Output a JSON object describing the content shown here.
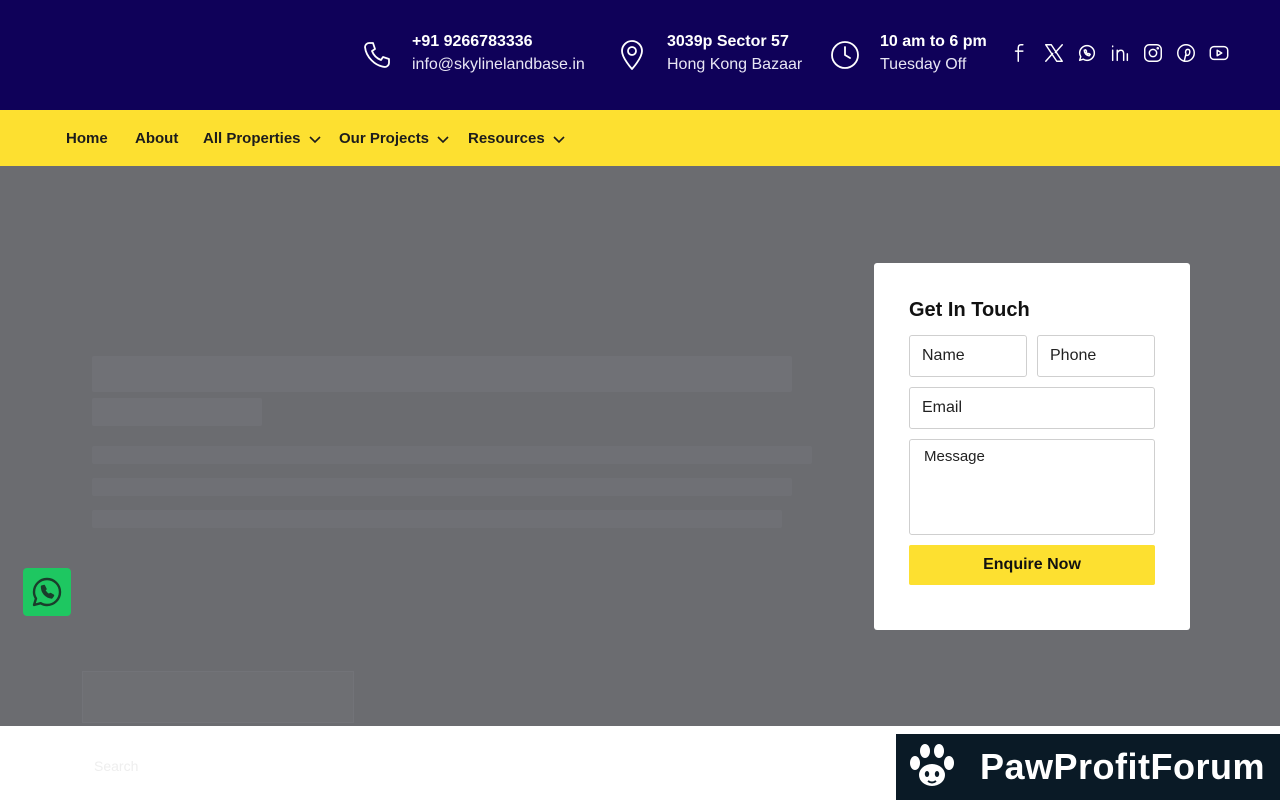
{
  "topbar": {
    "phone": {
      "title": "+91 9266783336",
      "subtitle": "info@skylinelandbase.in",
      "icon": "phone-icon"
    },
    "address": {
      "title": "3039p Sector 57",
      "subtitle": "Hong Kong Bazaar",
      "icon": "location-pin-icon"
    },
    "hours": {
      "title": "10 am to 6 pm",
      "subtitle": "Tuesday Off",
      "icon": "clock-icon"
    },
    "social": [
      "facebook-icon",
      "x-twitter-icon",
      "whatsapp-icon",
      "linkedin-icon",
      "instagram-icon",
      "pinterest-icon",
      "youtube-icon"
    ]
  },
  "nav": {
    "items": [
      {
        "label": "Home",
        "has_dropdown": false
      },
      {
        "label": "About",
        "has_dropdown": false
      },
      {
        "label": "All Properties",
        "has_dropdown": true
      },
      {
        "label": "Our Projects",
        "has_dropdown": true
      },
      {
        "label": "Resources",
        "has_dropdown": true
      }
    ]
  },
  "form": {
    "title": "Get In Touch",
    "name_placeholder": "Name",
    "phone_placeholder": "Phone",
    "email_placeholder": "Email",
    "message_placeholder": "Message",
    "submit_label": "Enquire Now"
  },
  "below": {
    "search_label": "Search"
  },
  "watermark": {
    "text": "PawProfitForum"
  },
  "colors": {
    "topbar_bg": "#0f0159",
    "nav_bg": "#fde030",
    "hero_overlay": "#6b6c70",
    "button_bg": "#fde030",
    "whatsapp_green": "#1ec761"
  }
}
